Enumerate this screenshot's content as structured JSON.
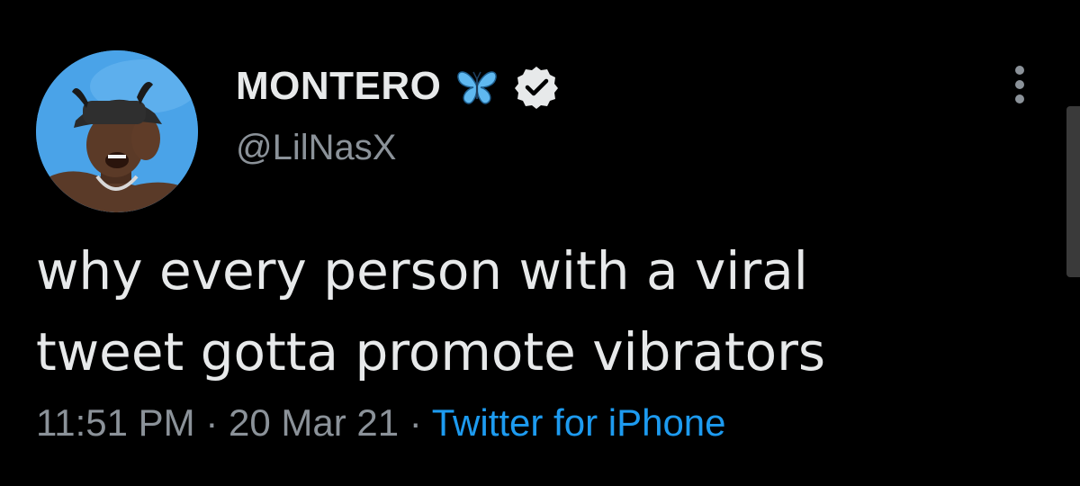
{
  "tweet": {
    "display_name": "MONTERO",
    "handle": "@LilNasX",
    "text_line1": "why every person with a viral",
    "text_line2": "tweet gotta promote vibrators",
    "time": "11:51 PM",
    "separator": "·",
    "date": "20 Mar 21",
    "source": "Twitter for iPhone"
  },
  "icons": {
    "name_emoji": "butterfly-icon",
    "badge": "verified-badge-icon",
    "more": "more-vertical-icon"
  },
  "colors": {
    "background": "#000000",
    "text_primary": "#e7e9ea",
    "text_secondary": "#8b9299",
    "link": "#1d9bf0",
    "butterfly": "#5fb8f0"
  }
}
